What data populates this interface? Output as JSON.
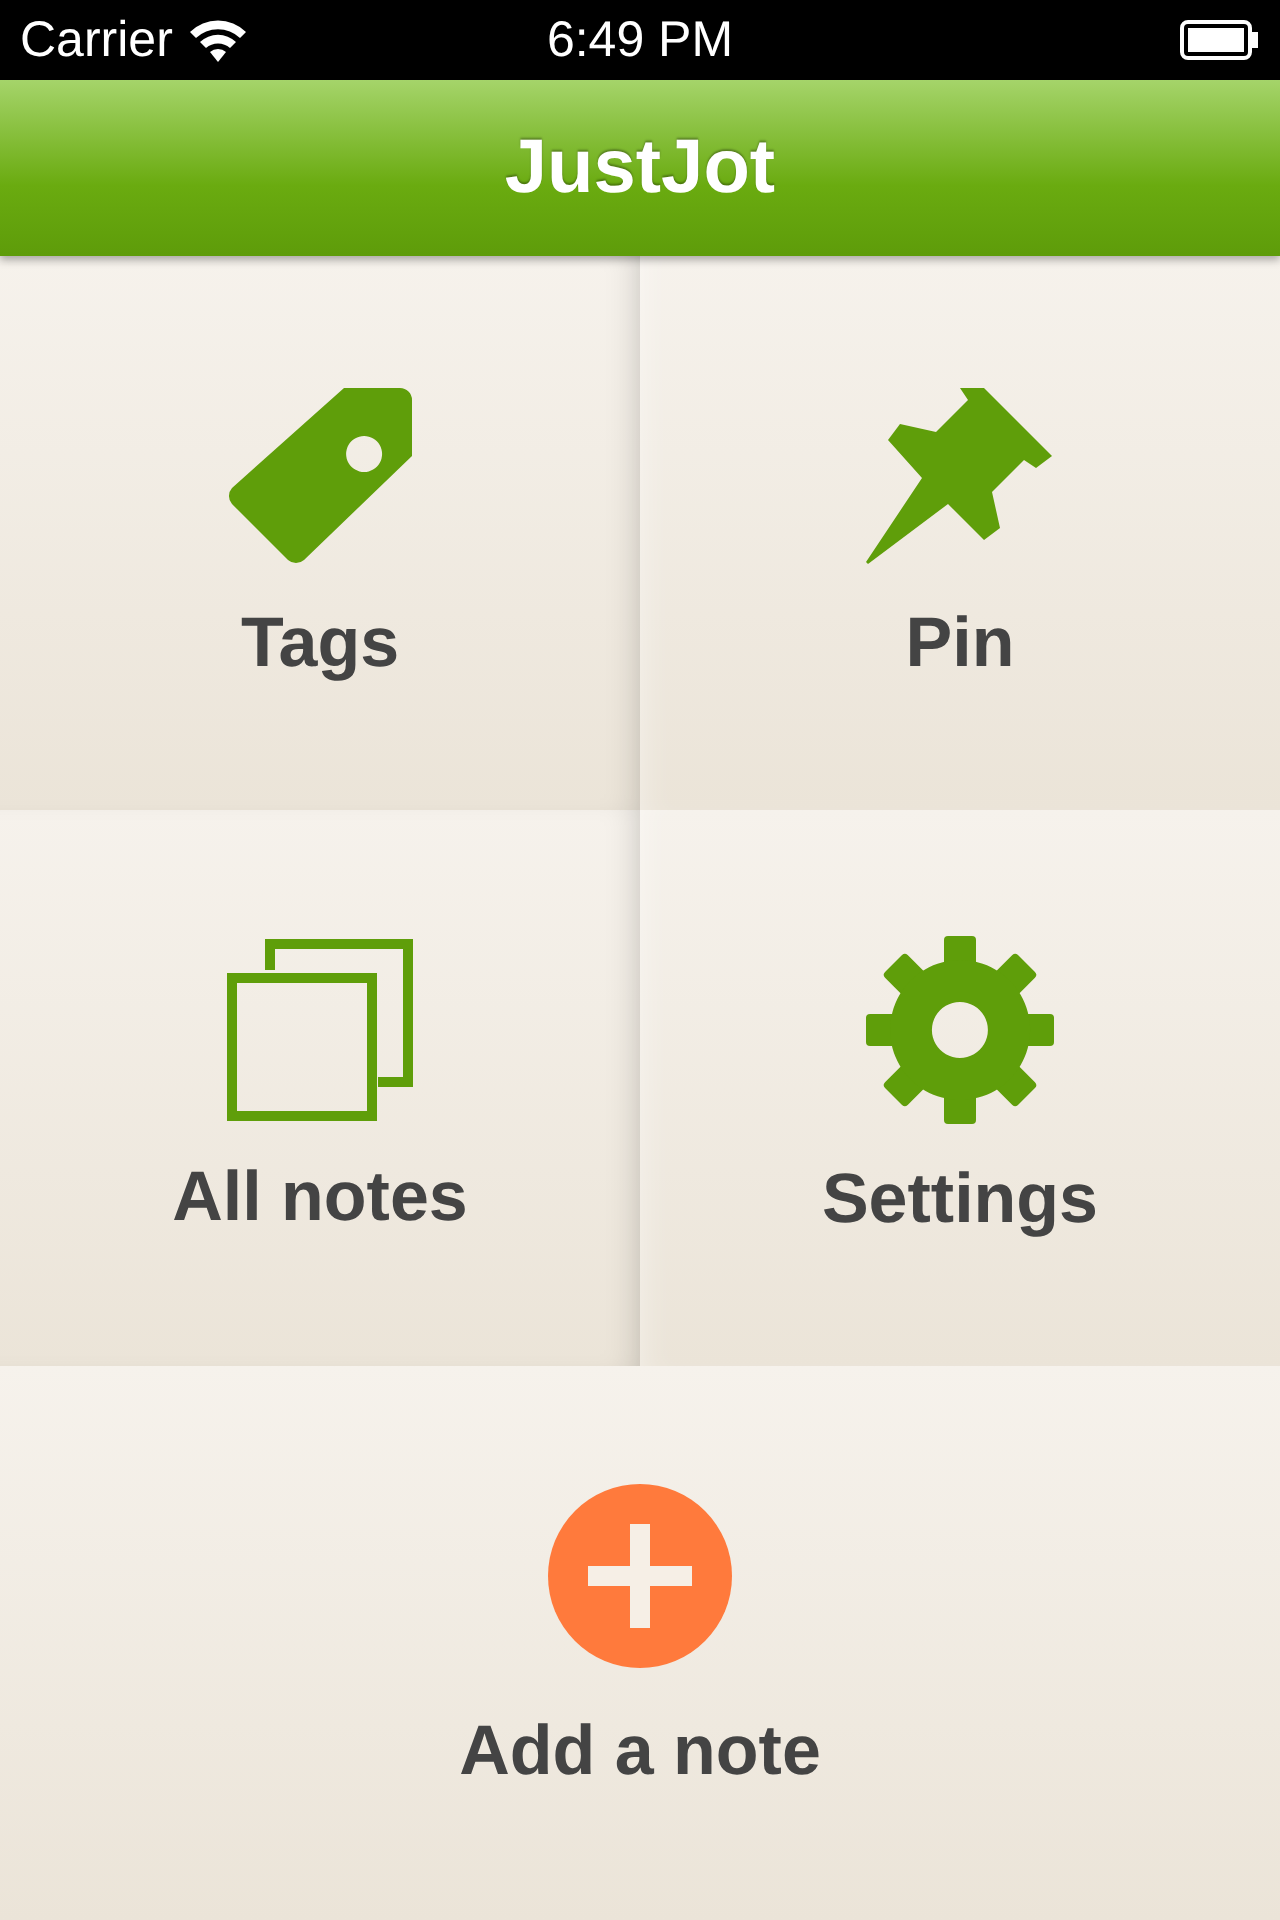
{
  "status_bar": {
    "carrier": "Carrier",
    "time": "6:49 PM"
  },
  "header": {
    "title": "JustJot"
  },
  "tiles": [
    {
      "kind": "tags",
      "label": "Tags"
    },
    {
      "kind": "pin",
      "label": "Pin"
    },
    {
      "kind": "notes",
      "label": "All notes"
    },
    {
      "kind": "settings",
      "label": "Settings"
    }
  ],
  "add_button": {
    "label": "Add a note"
  }
}
